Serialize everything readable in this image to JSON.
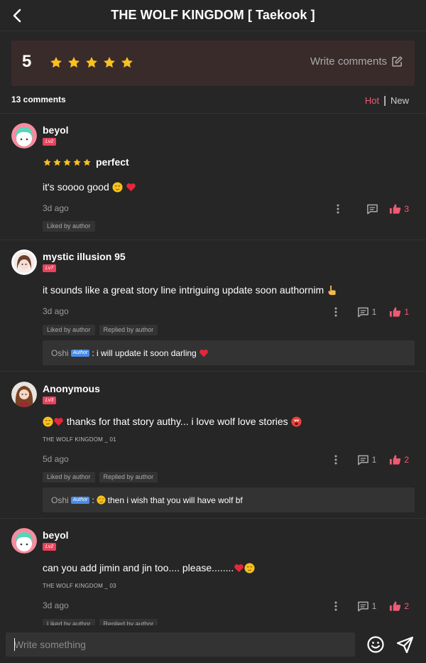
{
  "header": {
    "title": "THE WOLF KINGDOM [ Taekook ]"
  },
  "rating": {
    "value": "5",
    "stars": 5,
    "write_label": "Write comments"
  },
  "comments_header": {
    "count_label": "13 comments",
    "sort_hot": "Hot",
    "sort_sep": "|",
    "sort_new": "New"
  },
  "comments": [
    {
      "username": "beyol",
      "level": "Lv2",
      "rating_text": "perfect",
      "rating_stars": 5,
      "text": "it's soooo good",
      "date": "3d ago",
      "likes": "3",
      "badges": [
        "Liked by author"
      ]
    },
    {
      "username": "mystic illusion 95",
      "level": "Lv7",
      "text": "it sounds like a great story line intriguing update soon authornim",
      "date": "3d ago",
      "replies": "1",
      "likes": "1",
      "badges": [
        "Liked by author",
        "Replied by author"
      ],
      "reply": {
        "author": "Oshi",
        "tag": "Author",
        "text": ": i will update it soon darling"
      }
    },
    {
      "username": "Anonymous",
      "level": "Lv3",
      "text": "thanks for that story authy... i love wolf love stories",
      "ref": "THE WOLF KINGDOM _ 01",
      "date": "5d ago",
      "replies": "1",
      "likes": "2",
      "badges": [
        "Liked by author",
        "Replied by author"
      ],
      "reply": {
        "author": "Oshi",
        "tag": "Author",
        "text": "then i wish that you will have wolf bf"
      }
    },
    {
      "username": "beyol",
      "level": "Lv2",
      "text": "can you add jimin and jin too.... please........",
      "ref": "THE WOLF KINGDOM _ 03",
      "date": "3d ago",
      "replies": "1",
      "likes": "2",
      "badges": [
        "Liked by author",
        "Replied by author"
      ]
    }
  ],
  "composer": {
    "placeholder": "Write something"
  },
  "colors": {
    "accent": "#f05a73",
    "star": "#f7c21e",
    "background": "#262626",
    "panel": "#333333",
    "rating_card": "#3a2b2b"
  },
  "icons": {
    "back": "chevron-left-icon",
    "star": "star-icon",
    "edit": "edit-icon",
    "more": "more-vertical-icon",
    "reply": "comment-icon",
    "like": "thumbs-up-icon",
    "emoji": "smile-icon",
    "send": "send-icon"
  }
}
